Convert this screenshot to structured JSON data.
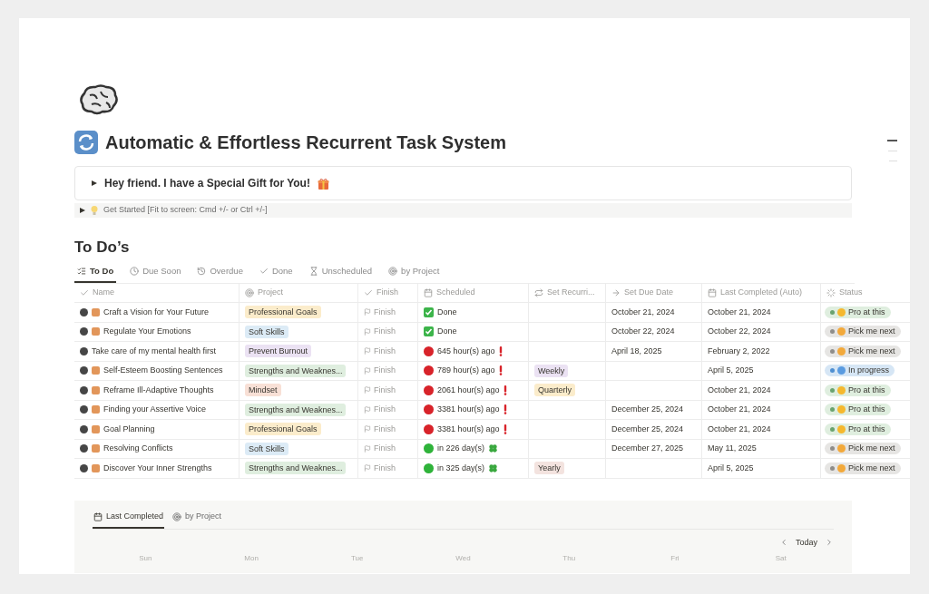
{
  "page": {
    "title": "Automatic & Effortless Recurrent Task System"
  },
  "callout": {
    "text": "Hey friend. I have a Special Gift for You!",
    "expanded": false
  },
  "toggle": {
    "text": "Get Started [Fit to screen: Cmd +/- or Ctrl +/-]",
    "expanded": false
  },
  "section": {
    "heading": "To Do’s"
  },
  "tabs": [
    {
      "label": "To Do",
      "kind": "list",
      "selected": true
    },
    {
      "label": "Due Soon",
      "kind": "clock",
      "selected": false
    },
    {
      "label": "Overdue",
      "kind": "history",
      "selected": false
    },
    {
      "label": "Done",
      "kind": "check",
      "selected": false
    },
    {
      "label": "Unscheduled",
      "kind": "hourglass",
      "selected": false
    },
    {
      "label": "by Project",
      "kind": "target",
      "selected": false
    }
  ],
  "table": {
    "columns": [
      {
        "label": "Name",
        "kind": "check"
      },
      {
        "label": "Project",
        "kind": "target"
      },
      {
        "label": "Finish",
        "kind": "check"
      },
      {
        "label": "Scheduled",
        "kind": "calendar"
      },
      {
        "label": "Set Recurri...",
        "kind": "repeat"
      },
      {
        "label": "Set Due Date",
        "kind": "arrow"
      },
      {
        "label": "Last Completed (Auto)",
        "kind": "calendar"
      },
      {
        "label": "Status",
        "kind": "loader"
      }
    ],
    "rows": [
      {
        "name": "Craft a Vision for Your Future",
        "has_icon": true,
        "project": {
          "text": "Professional Goals",
          "color": "#fbeccb"
        },
        "finish": "Finish",
        "scheduled": {
          "kind": "done",
          "text": "Done"
        },
        "due_date": "October 21, 2024",
        "last_completed": "October 21, 2024",
        "status": {
          "kind": "pro",
          "text": "Pro at this"
        }
      },
      {
        "name": "Regulate Your Emotions",
        "has_icon": true,
        "project": {
          "text": "Soft Skills",
          "color": "#dcebf6"
        },
        "finish": "Finish",
        "scheduled": {
          "kind": "done",
          "text": "Done"
        },
        "due_date": "October 22, 2024",
        "last_completed": "October 22, 2024",
        "status": {
          "kind": "next",
          "text": "Pick me next"
        }
      },
      {
        "name": "Take care of my mental health first",
        "has_icon": false,
        "project": {
          "text": "Prevent Burnout",
          "color": "#ebe2f3"
        },
        "finish": "Finish",
        "scheduled": {
          "kind": "overdue",
          "text": "645 hour(s) ago"
        },
        "due_date": "April 18, 2025",
        "last_completed": "February 2, 2022",
        "status": {
          "kind": "next",
          "text": "Pick me next"
        }
      },
      {
        "name": "Self-Esteem Boosting Sentences",
        "has_icon": true,
        "project": {
          "text": "Strengths and Weaknes...",
          "color": "#dfeedf"
        },
        "finish": "Finish",
        "scheduled": {
          "kind": "overdue",
          "text": "789 hour(s) ago"
        },
        "recurrence": {
          "text": "Weekly",
          "color": "#ebe2f3"
        },
        "last_completed": "April 5, 2025",
        "status": {
          "kind": "progress",
          "text": "In progress"
        }
      },
      {
        "name": "Reframe Ill-Adaptive Thoughts",
        "has_icon": true,
        "project": {
          "text": "Mindset",
          "color": "#f8e0d6"
        },
        "finish": "Finish",
        "scheduled": {
          "kind": "overdue",
          "text": "2061 hour(s) ago"
        },
        "recurrence": {
          "text": "Quarterly",
          "color": "#fbeccb"
        },
        "last_completed": "October 21, 2024",
        "status": {
          "kind": "pro",
          "text": "Pro at this"
        }
      },
      {
        "name": "Finding your Assertive Voice",
        "has_icon": true,
        "project": {
          "text": "Strengths and Weaknes...",
          "color": "#dfeedf"
        },
        "finish": "Finish",
        "scheduled": {
          "kind": "overdue",
          "text": "3381 hour(s) ago"
        },
        "due_date": "December 25, 2024",
        "last_completed": "October 21, 2024",
        "status": {
          "kind": "pro",
          "text": "Pro at this"
        }
      },
      {
        "name": "Goal Planning",
        "has_icon": true,
        "project": {
          "text": "Professional Goals",
          "color": "#fbeccb"
        },
        "finish": "Finish",
        "scheduled": {
          "kind": "overdue",
          "text": "3381 hour(s) ago"
        },
        "due_date": "December 25, 2024",
        "last_completed": "October 21, 2024",
        "status": {
          "kind": "pro",
          "text": "Pro at this"
        }
      },
      {
        "name": "Resolving Conflicts",
        "has_icon": true,
        "project": {
          "text": "Soft Skills",
          "color": "#dcebf6"
        },
        "finish": "Finish",
        "scheduled": {
          "kind": "upcoming",
          "text": "in 226 day(s)"
        },
        "due_date": "December 27, 2025",
        "last_completed": "May 11, 2025",
        "status": {
          "kind": "next",
          "text": "Pick me next"
        }
      },
      {
        "name": "Discover Your Inner Strengths",
        "has_icon": true,
        "project": {
          "text": "Strengths and Weaknes...",
          "color": "#dfeedf"
        },
        "finish": "Finish",
        "scheduled": {
          "kind": "upcoming",
          "text": "in 325 day(s)"
        },
        "recurrence": {
          "text": "Yearly",
          "color": "#f3e3df"
        },
        "last_completed": "April 5, 2025",
        "status": {
          "kind": "next",
          "text": "Pick me next"
        }
      }
    ]
  },
  "calendar": {
    "tabs": [
      {
        "label": "Last Completed",
        "kind": "calendar",
        "selected": true
      },
      {
        "label": "by Project",
        "kind": "target",
        "selected": false
      }
    ],
    "today": "Today",
    "days": [
      "Sun",
      "Mon",
      "Tue",
      "Wed",
      "Thu",
      "Fri",
      "Sat"
    ]
  }
}
